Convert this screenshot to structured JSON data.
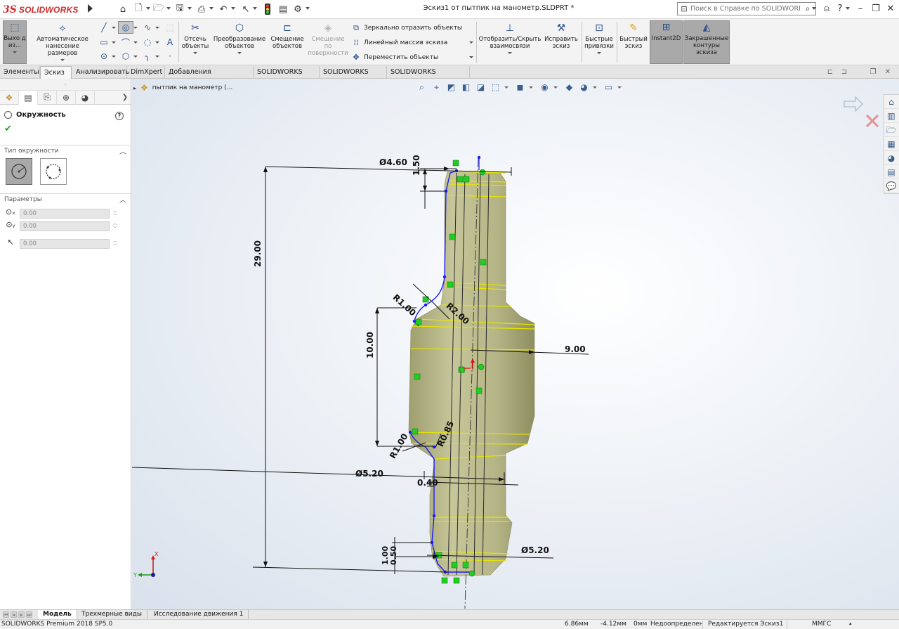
{
  "app": {
    "logo_mark": "3S",
    "logo_text": "SOLIDWORKS",
    "doc_title": "Эскиз1 от пытпик на манометр.SLDPRT *",
    "help_search_placeholder": "Поиск в Справке по SOLIDWORKS",
    "quick_access_icons": [
      "home-icon",
      "new-document-icon",
      "open-icon",
      "save-icon",
      "print-icon",
      "undo-icon",
      "select-icon",
      "rebuild-icon",
      "file-properties-icon",
      "options-icon"
    ],
    "window_controls": [
      "user-icon",
      "help-icon",
      "minimize-icon",
      "restore-icon",
      "close-icon"
    ]
  },
  "ribbon": {
    "exit_sketch": "Выхо д из...",
    "smart_dimension": "Автоматическое нанесение размеров",
    "trim": "Отсечь объекты",
    "convert": "Преобразование объектов",
    "offset": "Смещение объектов",
    "offset_surface": "Смещение по поверхности",
    "mirror": "Зеркально отразить объекты",
    "linear_pattern": "Линейный массив эскиза",
    "move": "Переместить объекты",
    "display_relations": "Отобразить/Скрыть взаимосвязи",
    "repair_sketch": "Исправить эскиз",
    "quick_snaps": "Быстрые привязки",
    "rapid_sketch": "Быстрый эскиз",
    "instant2d": "Instant2D",
    "shaded_contours": "Закрашенные контуры эскиза"
  },
  "command_tabs": [
    {
      "label": "Элементы",
      "active": false
    },
    {
      "label": "Эскиз",
      "active": true
    },
    {
      "label": "Анализировать",
      "active": false
    },
    {
      "label": "DimXpert",
      "active": false
    },
    {
      "label": "Добавления SOLIDWORKS",
      "active": false
    },
    {
      "label": "SOLIDWORKS MBD",
      "active": false
    },
    {
      "label": "SOLIDWORKS CAM",
      "active": false
    },
    {
      "label": "SOLIDWORKS Inspection",
      "active": false
    }
  ],
  "property_manager": {
    "title": "Окружность",
    "help": "?",
    "section_type": "Тип окружности",
    "section_params": "Параметры",
    "cx": "0.00",
    "cy": "0.00",
    "radius": "0.00"
  },
  "graphics": {
    "tree_item": "пытпик на манометр (...",
    "dims": {
      "d_top": "Ø4.60",
      "h_top": "1.50",
      "total": "29.00",
      "r1_upper": "R1.00",
      "r2": "R2.00",
      "h_mid": "10.00",
      "w_mid": "9.00",
      "r1_lower": "R1.00",
      "r085": "R0.85",
      "d_neck": "Ø5.20",
      "h_040": "0.40",
      "d_bottom": "Ø5.20",
      "h_bot1": "1.00",
      "h_bot2": "0.50"
    },
    "triad_x": "X",
    "triad_y": "Y"
  },
  "bottom_tabs": [
    {
      "label": "Модель",
      "active": true
    },
    {
      "label": "Трехмерные виды",
      "active": false
    },
    {
      "label": "Исследование движения 1",
      "active": false
    }
  ],
  "status": {
    "product": "SOLIDWORKS Premium 2018 SP5.0",
    "x": "6.86мм",
    "y": "-4.12мм",
    "z": "0мм",
    "state": "Недоопределен",
    "editing": "Редактируется Эскиз1",
    "units": "ММГС"
  },
  "colors": {
    "brand": "#d12c2c",
    "part_body": "#b9b98a",
    "sketch_blue": "#1a1aff",
    "relation_green": "#22cc22",
    "edge_yellow": "#e6e600"
  }
}
